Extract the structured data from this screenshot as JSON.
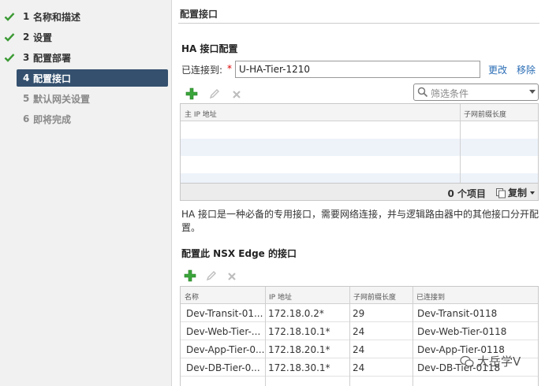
{
  "sidebar": {
    "steps": [
      {
        "num": "1",
        "label": "名称和描述",
        "state": "done"
      },
      {
        "num": "2",
        "label": "设置",
        "state": "done"
      },
      {
        "num": "3",
        "label": "配置部署",
        "state": "done"
      },
      {
        "num": "4",
        "label": "配置接口",
        "state": "active"
      },
      {
        "num": "5",
        "label": "默认网关设置",
        "state": "pending"
      },
      {
        "num": "6",
        "label": "即将完成",
        "state": "pending"
      }
    ]
  },
  "main": {
    "title": "配置接口",
    "ha": {
      "title": "HA 接口配置",
      "connected_label": "已连接到:",
      "required_mark": "*",
      "connected_value": "U-HA-Tier-1210",
      "change_link": "更改",
      "remove_link": "移除",
      "filter_placeholder": "筛选条件",
      "columns": [
        "主 IP 地址",
        "子网前缀长度"
      ],
      "item_count": "0 个项目",
      "copy_label": "复制"
    },
    "description": "HA 接口是一种必备的专用接口，需要网络连接，并与逻辑路由器中的其他接口分开配置。",
    "interfaces": {
      "title": "配置此 NSX Edge 的接口",
      "columns": [
        "名称",
        "IP 地址",
        "子网前缀长度",
        "已连接到"
      ],
      "rows": [
        {
          "name": "Dev-Transit-01...",
          "ip": "172.18.0.2*",
          "prefix": "29",
          "connected": "Dev-Transit-0118"
        },
        {
          "name": "Dev-Web-Tier-...",
          "ip": "172.18.10.1*",
          "prefix": "24",
          "connected": "Dev-Web-Tier-0118"
        },
        {
          "name": "Dev-App-Tier-0...",
          "ip": "172.18.20.1*",
          "prefix": "24",
          "connected": "Dev-App-Tier-0118"
        },
        {
          "name": "Dev-DB-Tier-0...",
          "ip": "172.18.30.1*",
          "prefix": "24",
          "connected": "Dev-DB-Tier-0118"
        }
      ]
    }
  },
  "watermark": {
    "text": "大岳学V"
  },
  "colors": {
    "active_step": "#34506e",
    "check": "#3c9a35",
    "link": "#2a6db5",
    "add": "#3aa53a"
  }
}
